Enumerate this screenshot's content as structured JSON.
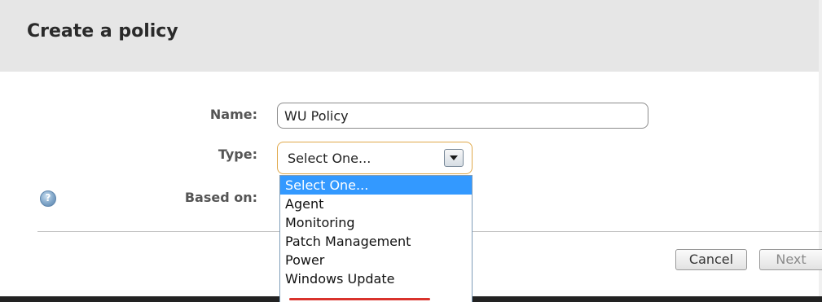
{
  "dialog": {
    "title": "Create a policy"
  },
  "form": {
    "name_label": "Name:",
    "name_value": "WU Policy",
    "type_label": "Type:",
    "type_value": "Select One...",
    "based_on_label": "Based on:"
  },
  "dropdown": {
    "options": [
      "Select One...",
      "Agent",
      "Monitoring",
      "Patch Management",
      "Power",
      "Windows Update"
    ],
    "selected_index": 0
  },
  "footer": {
    "cancel_label": "Cancel",
    "next_label": "Next"
  },
  "icons": {
    "help": "help-icon",
    "dropdown_arrow": "chevron-down-icon"
  },
  "colors": {
    "header_bg": "#e6e6e6",
    "select_border": "#e0a84a",
    "selection_highlight": "#3399ff",
    "annotation_underline": "#d9332c"
  }
}
